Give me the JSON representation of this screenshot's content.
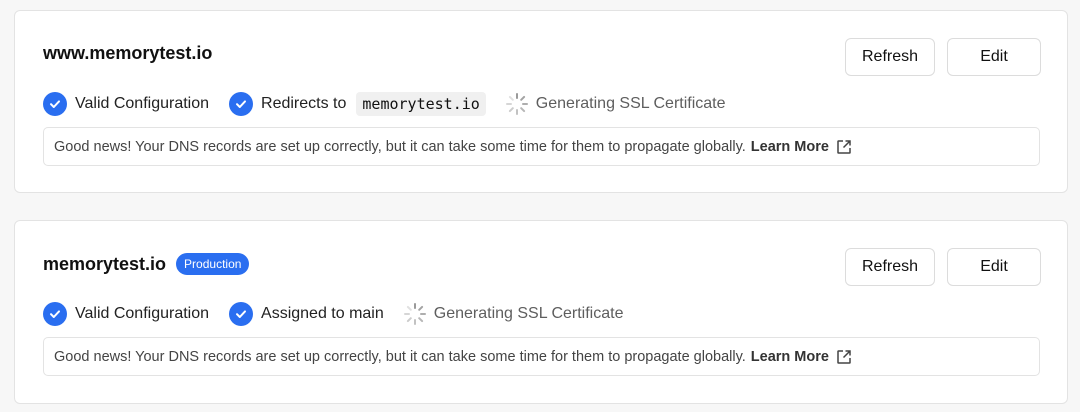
{
  "domains": [
    {
      "title": "www.memorytest.io",
      "badge": "",
      "buttons": {
        "refresh": "Refresh",
        "edit": "Edit"
      },
      "statuses": {
        "config": "Valid Configuration",
        "second": "Redirects to",
        "second_code": "memorytest.io",
        "ssl": "Generating SSL Certificate"
      },
      "notice": {
        "text": "Good news! Your DNS records are set up correctly, but it can take some time for them to propagate globally.",
        "link": "Learn More"
      }
    },
    {
      "title": "memorytest.io",
      "badge": "Production",
      "buttons": {
        "refresh": "Refresh",
        "edit": "Edit"
      },
      "statuses": {
        "config": "Valid Configuration",
        "second": "Assigned to main",
        "second_code": "",
        "ssl": "Generating SSL Certificate"
      },
      "notice": {
        "text": "Good news! Your DNS records are set up correctly, but it can take some time for them to propagate globally.",
        "link": "Learn More"
      }
    }
  ],
  "colors": {
    "accent": "#2a6ef0",
    "border": "#e3e3e3",
    "background": "#f7f7f7"
  },
  "icons": {
    "check": "check-circle-icon",
    "spinner": "loading-spinner-icon",
    "external": "external-link-icon"
  }
}
